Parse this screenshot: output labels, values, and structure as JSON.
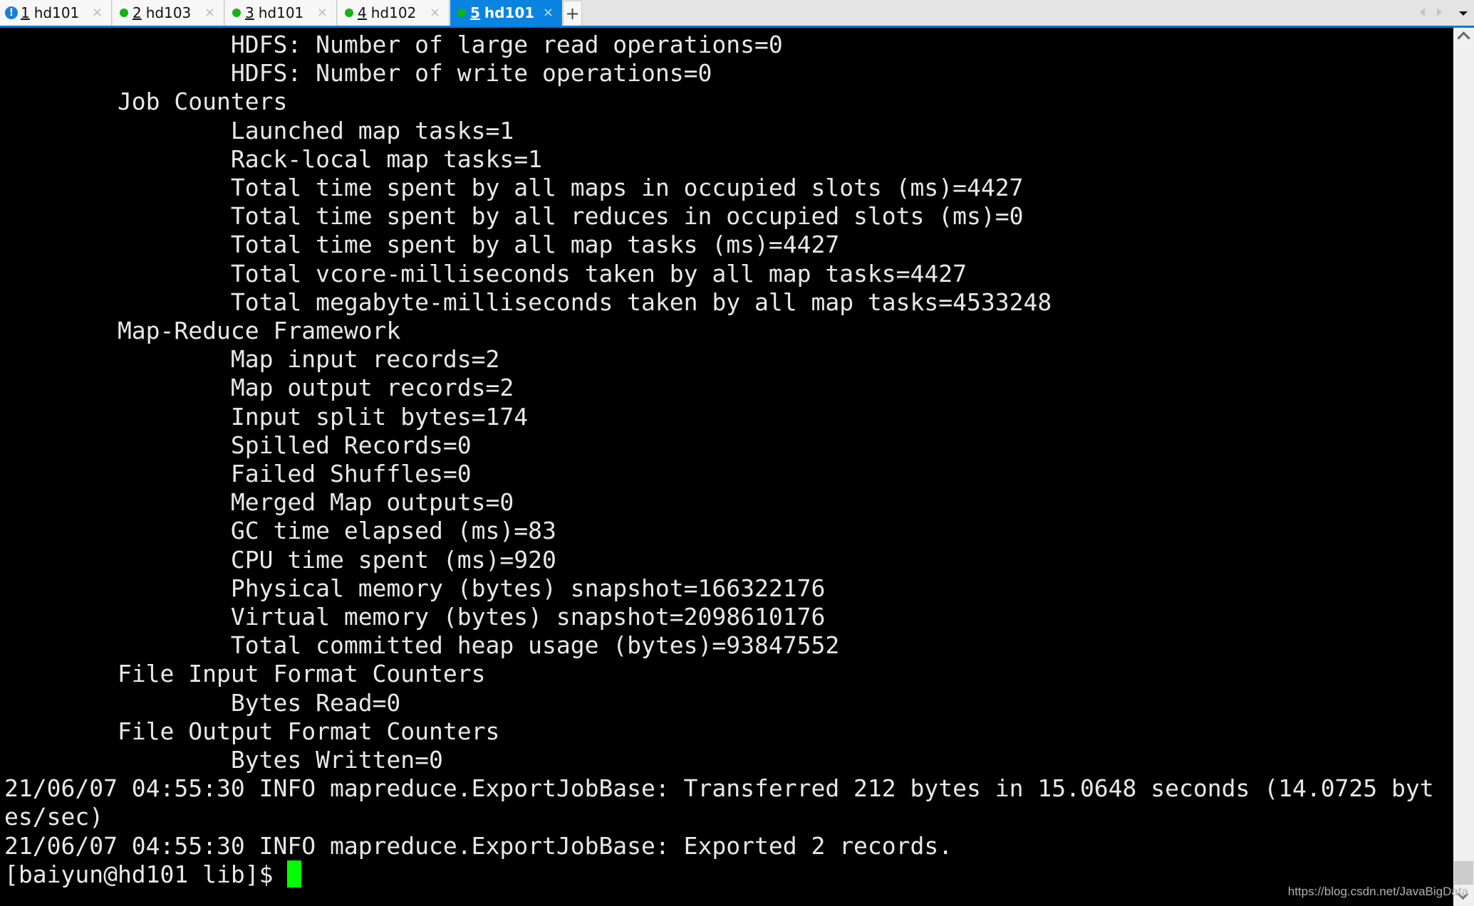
{
  "tabs": [
    {
      "number": "1",
      "label": "hd101",
      "status": "alert",
      "status_glyph": "!",
      "active": false,
      "close": "×"
    },
    {
      "number": "2",
      "label": "hd103",
      "status": "connected",
      "active": false,
      "close": "×"
    },
    {
      "number": "3",
      "label": "hd101",
      "status": "connected",
      "active": false,
      "close": "×"
    },
    {
      "number": "4",
      "label": "hd102",
      "status": "connected",
      "active": false,
      "close": "×"
    },
    {
      "number": "5",
      "label": "hd101",
      "status": "connected",
      "active": true,
      "close": "×"
    }
  ],
  "new_tab_label": "+",
  "colors": {
    "active_tab": "#0a84e0",
    "status_connected": "#12b312",
    "status_alert": "#1a7fd8",
    "cursor": "#00ff00",
    "terminal_bg": "#000000",
    "terminal_fg": "#e8e8e8"
  },
  "terminal": {
    "lines": [
      "                HDFS: Number of large read operations=0",
      "                HDFS: Number of write operations=0",
      "        Job Counters ",
      "                Launched map tasks=1",
      "                Rack-local map tasks=1",
      "                Total time spent by all maps in occupied slots (ms)=4427",
      "                Total time spent by all reduces in occupied slots (ms)=0",
      "                Total time spent by all map tasks (ms)=4427",
      "                Total vcore-milliseconds taken by all map tasks=4427",
      "                Total megabyte-milliseconds taken by all map tasks=4533248",
      "        Map-Reduce Framework",
      "                Map input records=2",
      "                Map output records=2",
      "                Input split bytes=174",
      "                Spilled Records=0",
      "                Failed Shuffles=0",
      "                Merged Map outputs=0",
      "                GC time elapsed (ms)=83",
      "                CPU time spent (ms)=920",
      "                Physical memory (bytes) snapshot=166322176",
      "                Virtual memory (bytes) snapshot=2098610176",
      "                Total committed heap usage (bytes)=93847552",
      "        File Input Format Counters ",
      "                Bytes Read=0",
      "        File Output Format Counters ",
      "                Bytes Written=0",
      "21/06/07 04:55:30 INFO mapreduce.ExportJobBase: Transferred 212 bytes in 15.0648 seconds (14.0725 byt",
      "es/sec)",
      "21/06/07 04:55:30 INFO mapreduce.ExportJobBase: Exported 2 records."
    ],
    "prompt": "[baiyun@hd101 lib]$ "
  },
  "watermark": "https://blog.csdn.net/JavaBigData"
}
